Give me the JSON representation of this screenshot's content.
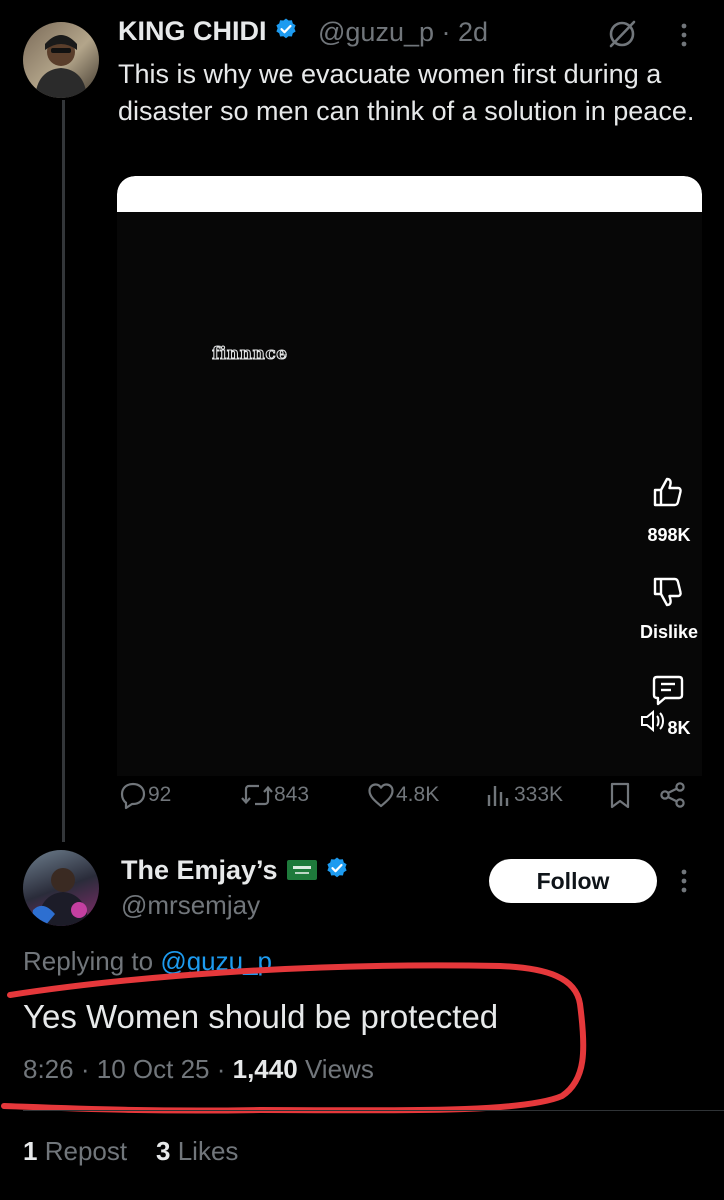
{
  "post": {
    "author_name": "KING CHIDI",
    "handle": "@guzu_p",
    "separator": "·",
    "age": "2d",
    "text": "This is why we evacuate women first during a disaster so men can think of a solution in peace.",
    "media": {
      "watermark": "finnnce",
      "like_count": "898K",
      "dislike_label": "Dislike",
      "comment_count": "8K"
    },
    "actions": {
      "replies": "92",
      "reposts": "843",
      "likes": "4.8K",
      "views": "333K"
    }
  },
  "reply": {
    "author_name": "The Emjay’s",
    "flag": "saudi-flag-icon",
    "handle": "@mrsemjay",
    "follow_label": "Follow",
    "replying_prefix": "Replying to",
    "replying_mention": "@guzu_p",
    "text": "Yes Women should be protected",
    "time": "8:26",
    "date": "10 Oct 25",
    "sep": "·",
    "views_count": "1,440",
    "views_label": "Views",
    "reposts_count": "1",
    "reposts_label": "Repost",
    "likes_count": "3",
    "likes_label": "Likes"
  },
  "colors": {
    "accent": "#1d9bf0",
    "annotation": "#e5383b"
  }
}
